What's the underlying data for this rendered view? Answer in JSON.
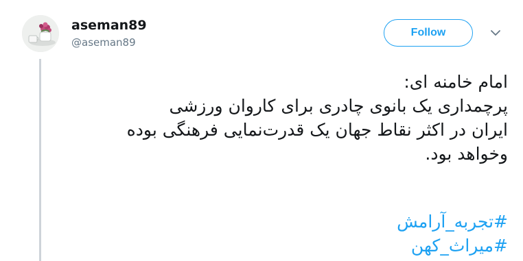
{
  "user": {
    "name": "aseman89",
    "handle": "@aseman89"
  },
  "follow_label": "Follow",
  "tweet": {
    "lines": [
      "امام خامنه ای:",
      "پرچمداری یک بانوی چادری برای کاروان ورزشی",
      "ایران در اکثر نقاط جهان یک قدرت‌نمایی فرهنگی بوده",
      "وخواهد بود."
    ],
    "hashtags": [
      "#تجربه_آرامش",
      "#میراث_کهن"
    ]
  },
  "colors": {
    "accent": "#1da1f2",
    "text": "#14171a",
    "muted": "#657786",
    "thread_line": "#cdd3d9"
  },
  "icons": {
    "avatar": "avatar-flowers-teacup",
    "caret": "chevron-down-icon"
  }
}
